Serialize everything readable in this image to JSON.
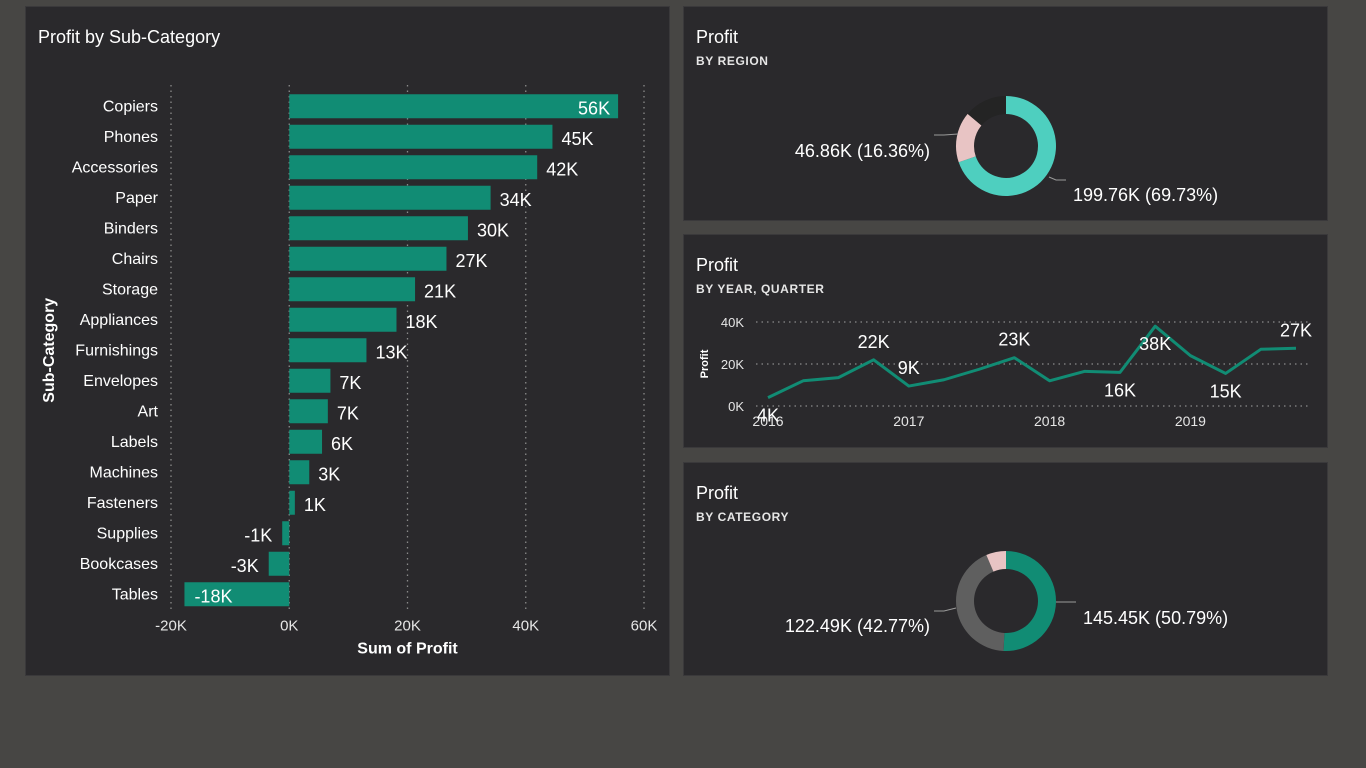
{
  "colors": {
    "background": "#474644",
    "panel": "#2a292c",
    "teal": "#118c74",
    "light_teal": "#4ecfbf",
    "pink": "#e8c4c4",
    "gray": "#5f5f5f",
    "dark_slice": "#242424"
  },
  "panels": {
    "subcategory": {
      "title": "Profit by Sub-Category"
    },
    "region": {
      "title": "Profit",
      "subtitle": "BY REGION"
    },
    "time": {
      "title": "Profit",
      "subtitle": "BY YEAR, QUARTER"
    },
    "category": {
      "title": "Profit",
      "subtitle": "BY CATEGORY"
    }
  },
  "chart_data": [
    {
      "type": "bar",
      "orientation": "horizontal",
      "title": "Profit by Sub-Category",
      "xlabel": "Sum of Profit",
      "ylabel": "Sub-Category",
      "xlim": [
        -20000,
        60000
      ],
      "xticks": [
        {
          "value": -20000,
          "label": "-20K"
        },
        {
          "value": 0,
          "label": "0K"
        },
        {
          "value": 20000,
          "label": "20K"
        },
        {
          "value": 40000,
          "label": "40K"
        },
        {
          "value": 60000,
          "label": "60K"
        }
      ],
      "grid": true,
      "categories": [
        "Copiers",
        "Phones",
        "Accessories",
        "Paper",
        "Binders",
        "Chairs",
        "Storage",
        "Appliances",
        "Furnishings",
        "Envelopes",
        "Art",
        "Labels",
        "Machines",
        "Fasteners",
        "Supplies",
        "Bookcases",
        "Tables"
      ],
      "values": [
        55618,
        44516,
        41937,
        34054,
        30222,
        26590,
        21279,
        18138,
        13059,
        6964,
        6528,
        5546,
        3385,
        950,
        -1189,
        -3473,
        -17725
      ],
      "data_labels": [
        "56K",
        "45K",
        "42K",
        "34K",
        "30K",
        "27K",
        "21K",
        "18K",
        "13K",
        "7K",
        "7K",
        "6K",
        "3K",
        "1K",
        "-1K",
        "-3K",
        "-18K"
      ]
    },
    {
      "type": "pie",
      "variant": "donut",
      "subtitle": "BY REGION",
      "slices": [
        {
          "value": 69.73,
          "color": "#4ecfbf"
        },
        {
          "value": 16.36,
          "color": "#e8c4c4"
        },
        {
          "value": 13.91,
          "color": "#242424"
        }
      ],
      "annotations": [
        {
          "text": "199.76K (69.73%)",
          "side": "right"
        },
        {
          "text": "46.86K (16.36%)",
          "side": "left"
        }
      ]
    },
    {
      "type": "line",
      "subtitle": "BY YEAR, QUARTER",
      "ylabel": "Profit",
      "ylim": [
        0,
        40000
      ],
      "yticks": [
        {
          "value": 0,
          "label": "0K"
        },
        {
          "value": 20000,
          "label": "20K"
        },
        {
          "value": 40000,
          "label": "40K"
        }
      ],
      "grid": true,
      "x": [
        "2016 Q1",
        "2016 Q2",
        "2016 Q3",
        "2016 Q4",
        "2017 Q1",
        "2017 Q2",
        "2017 Q3",
        "2017 Q4",
        "2018 Q1",
        "2018 Q2",
        "2018 Q3",
        "2018 Q4",
        "2019 Q1",
        "2019 Q2",
        "2019 Q3",
        "2019 Q4"
      ],
      "xtick_labels": [
        "2016",
        "2017",
        "2018",
        "2019"
      ],
      "values": [
        4000,
        12000,
        13500,
        22000,
        9500,
        12500,
        17500,
        23000,
        12000,
        16500,
        16000,
        38000,
        24000,
        15500,
        27000,
        27500
      ],
      "data_labels": [
        {
          "index": 0,
          "label": "4K",
          "pos": "below"
        },
        {
          "index": 3,
          "label": "22K",
          "pos": "above"
        },
        {
          "index": 4,
          "label": "9K",
          "pos": "above"
        },
        {
          "index": 7,
          "label": "23K",
          "pos": "above"
        },
        {
          "index": 10,
          "label": "16K",
          "pos": "below"
        },
        {
          "index": 11,
          "label": "38K",
          "pos": "below"
        },
        {
          "index": 13,
          "label": "15K",
          "pos": "below"
        },
        {
          "index": 15,
          "label": "27K",
          "pos": "above"
        }
      ]
    },
    {
      "type": "pie",
      "variant": "donut",
      "subtitle": "BY CATEGORY",
      "slices": [
        {
          "value": 50.79,
          "color": "#118c74"
        },
        {
          "value": 42.77,
          "color": "#5f5f5f"
        },
        {
          "value": 6.44,
          "color": "#e8c4c4"
        }
      ],
      "annotations": [
        {
          "text": "145.45K (50.79%)",
          "side": "right"
        },
        {
          "text": "122.49K (42.77%)",
          "side": "left"
        }
      ]
    }
  ]
}
